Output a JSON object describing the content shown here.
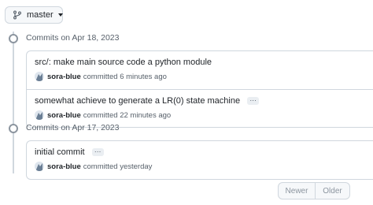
{
  "branch": {
    "name": "master"
  },
  "groups": [
    {
      "title": "Commits on Apr 18, 2023",
      "commits": [
        {
          "title": "src/: make main source code a python module",
          "author": "sora-blue",
          "time": "committed 6 minutes ago",
          "has_ellipsis": false
        },
        {
          "title": "somewhat achieve to generate a LR(0) state machine",
          "author": "sora-blue",
          "time": "committed 22 minutes ago",
          "has_ellipsis": true
        }
      ]
    },
    {
      "title": "Commits on Apr 17, 2023",
      "commits": [
        {
          "title": "initial commit",
          "author": "sora-blue",
          "time": "committed yesterday",
          "has_ellipsis": true
        }
      ]
    }
  ],
  "ellipsis_label": "…",
  "pagination": {
    "newer": "Newer",
    "older": "Older"
  },
  "icons": {
    "branch": "git-branch-icon",
    "caret": "chevron-down-icon"
  }
}
